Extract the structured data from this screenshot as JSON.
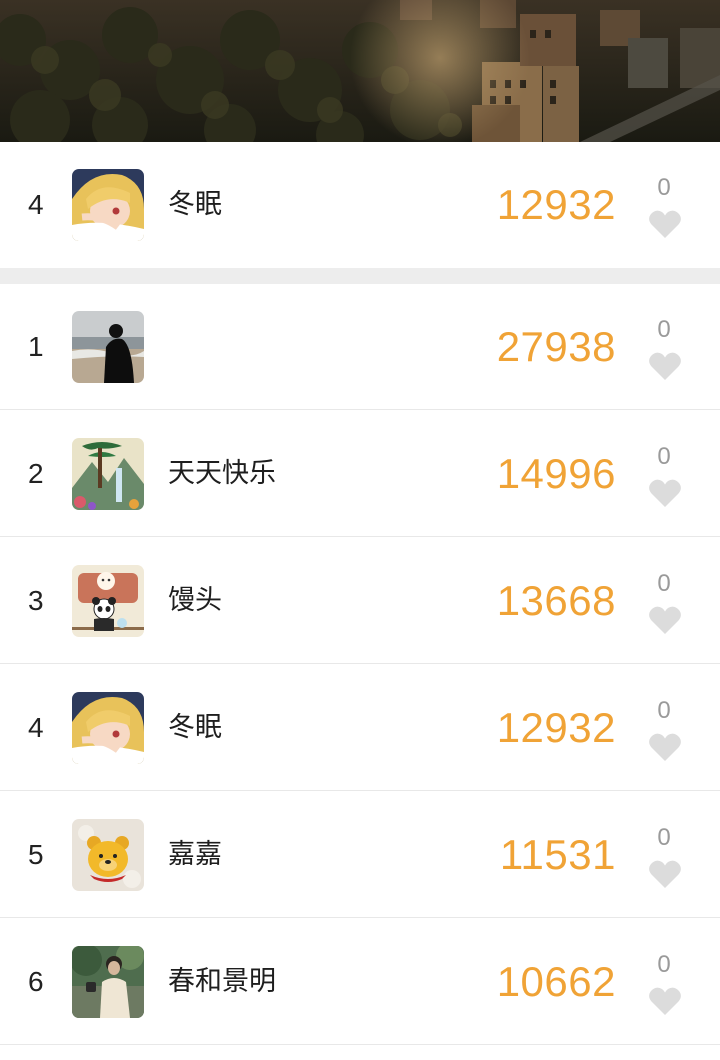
{
  "my_rank": {
    "rank": "4",
    "avatar": "anime-girl-avatar",
    "name": "冬眠",
    "steps": "12932",
    "likes": "0"
  },
  "leaderboard": [
    {
      "rank": "1",
      "avatar": "beach-silhouette-avatar",
      "name": "",
      "steps": "27938",
      "likes": "0"
    },
    {
      "rank": "2",
      "avatar": "landscape-painting-avatar",
      "name": "天天快乐",
      "steps": "14996",
      "likes": "0"
    },
    {
      "rank": "3",
      "avatar": "panda-train-avatar",
      "name": "馒头",
      "steps": "13668",
      "likes": "0"
    },
    {
      "rank": "4",
      "avatar": "anime-girl-avatar",
      "name": "冬眠",
      "steps": "12932",
      "likes": "0"
    },
    {
      "rank": "5",
      "avatar": "bear-plush-avatar",
      "name": "嘉嘉",
      "steps": "11531",
      "likes": "0"
    },
    {
      "rank": "6",
      "avatar": "man-in-park-avatar",
      "name": "春和景明",
      "steps": "10662",
      "likes": "0"
    }
  ],
  "colors": {
    "steps": "#f0a336",
    "heart": "#dcdcdc",
    "separator": "#ededed"
  },
  "icons": {
    "like": "heart-icon"
  }
}
